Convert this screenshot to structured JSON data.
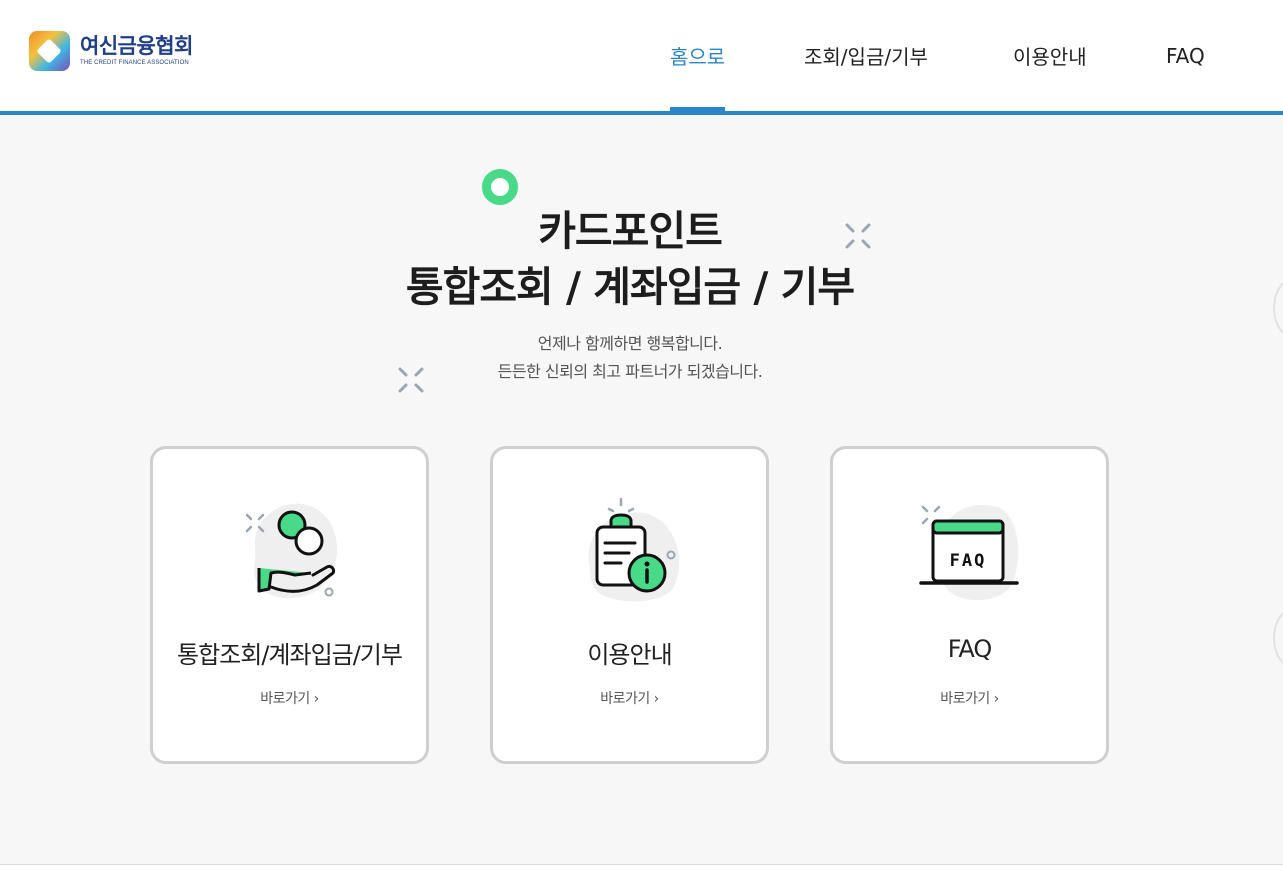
{
  "brand": {
    "name_ko": "여신금융협회",
    "name_en": "THE CREDIT FINANCE ASSOCIATION"
  },
  "nav": {
    "items": [
      {
        "label": "홈으로",
        "active": true
      },
      {
        "label": "조회/입금/기부",
        "active": false
      },
      {
        "label": "이용안내",
        "active": false
      },
      {
        "label": "FAQ",
        "active": false
      }
    ]
  },
  "hero": {
    "title_line1": "카드포인트",
    "title_line2": "통합조회 / 계좌입금 / 기부",
    "sub_line1": "언제나 함께하면 행복합니다.",
    "sub_line2": "든든한 신뢰의 최고 파트너가 되겠습니다."
  },
  "cards": [
    {
      "title": "통합조회/계좌입금/기부",
      "link": "바로가기 ›",
      "icon": "coin-hand-icon"
    },
    {
      "title": "이용안내",
      "link": "바로가기 ›",
      "icon": "clipboard-info-icon"
    },
    {
      "title": "FAQ",
      "link": "바로가기 ›",
      "icon": "faq-monitor-icon"
    }
  ],
  "colors": {
    "accent": "#2b86c9",
    "brand": "#1f3f86",
    "green": "#48d989",
    "card_border": "#cfcfcf"
  }
}
